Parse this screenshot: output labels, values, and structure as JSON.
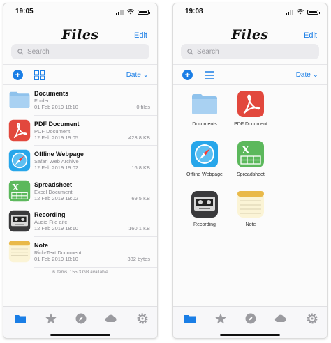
{
  "left": {
    "time": "19:05",
    "title": "Files",
    "edit_label": "Edit",
    "search_placeholder": "Search",
    "sort_label": "Date",
    "files": [
      {
        "name": "Documents",
        "kind": "Folder",
        "date": "01 Feb 2019 18:10",
        "size": "0 files",
        "icon": "folder-icon"
      },
      {
        "name": "PDF Document",
        "kind": "PDF Document",
        "date": "12 Feb 2019 19:05",
        "size": "423.8 KB",
        "icon": "pdf-icon"
      },
      {
        "name": "Offline Webpage",
        "kind": "Safari Web Archive",
        "date": "12 Feb 2019 19:02",
        "size": "16.8 KB",
        "icon": "safari-icon"
      },
      {
        "name": "Spreadsheet",
        "kind": "Excel Document",
        "date": "12 Feb 2019 19:02",
        "size": "69.5 KB",
        "icon": "spreadsheet-icon"
      },
      {
        "name": "Recording",
        "kind": "Audio File aifc",
        "date": "12 Feb 2019 18:10",
        "size": "160.1 KB",
        "icon": "recording-icon"
      },
      {
        "name": "Note",
        "kind": "Rich-Text Document",
        "date": "01 Feb 2019 18:10",
        "size": "382 bytes",
        "icon": "note-icon"
      }
    ],
    "footer": "6 items, 155.3 GB available"
  },
  "right": {
    "time": "19:08",
    "title": "Files",
    "edit_label": "Edit",
    "search_placeholder": "Search",
    "sort_label": "Date",
    "grid": [
      {
        "label": "Documents",
        "icon": "folder-icon"
      },
      {
        "label": "PDF Document",
        "icon": "pdf-icon"
      },
      {
        "label": "Offline Webpage",
        "icon": "safari-icon"
      },
      {
        "label": "Spreadsheet",
        "icon": "spreadsheet-icon"
      },
      {
        "label": "Recording",
        "icon": "recording-icon"
      },
      {
        "label": "Note",
        "icon": "note-icon"
      }
    ]
  },
  "tabs": [
    {
      "icon": "folder-tab-icon",
      "active": true
    },
    {
      "icon": "star-icon",
      "active": false
    },
    {
      "icon": "compass-icon",
      "active": false
    },
    {
      "icon": "cloud-icon",
      "active": false
    },
    {
      "icon": "gear-icon",
      "active": false
    }
  ],
  "colors": {
    "accent": "#1a7ee6",
    "inactive_tab": "#9b9ba0",
    "background": "#fbfbfb"
  }
}
